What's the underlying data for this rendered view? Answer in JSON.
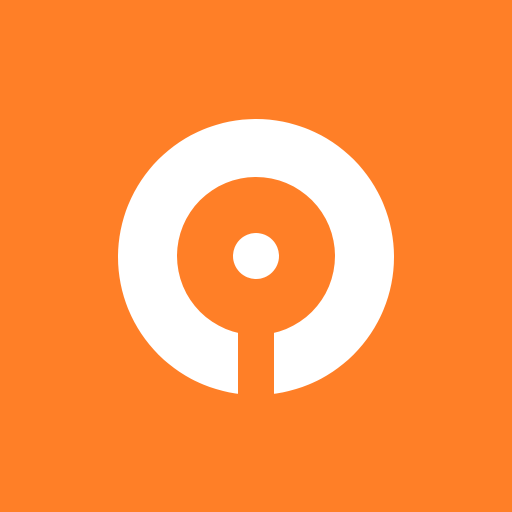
{
  "colors": {
    "background": "#FF7F27",
    "mark": "#FFFFFF"
  },
  "icon": {
    "name": "location-pin-ring-icon"
  }
}
